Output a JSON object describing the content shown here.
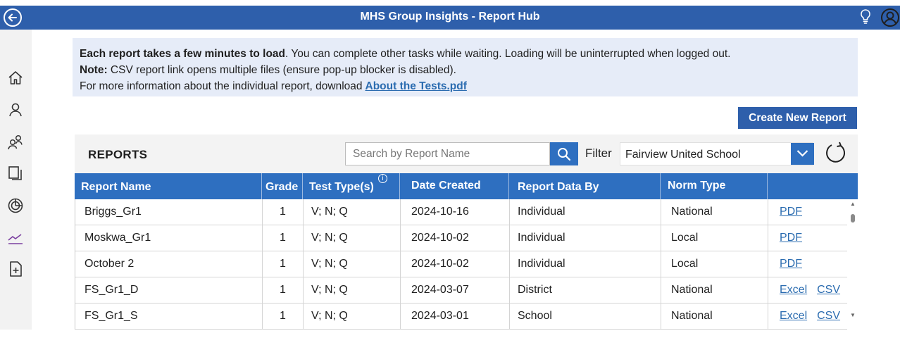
{
  "header": {
    "title": "MHS Group Insights - Report Hub"
  },
  "banner": {
    "line1_bold": "Each report takes a few minutes to load",
    "line1_rest": ". You can complete other tasks while waiting. Loading will be uninterrupted when logged out.",
    "line2_bold": "Note:",
    "line2_rest": " CSV report link opens multiple files (ensure pop-up blocker is disabled).",
    "line3_text": "For more information about the individual report, download",
    "line3_link": "About the Tests.pdf"
  },
  "actions": {
    "create_label": "Create New Report"
  },
  "reports": {
    "title": "REPORTS",
    "search_placeholder": "Search by Report Name",
    "filter_label": "Filter",
    "filter_value": "Fairview United School",
    "columns": [
      "Report Name",
      "Grade",
      "Test Type(s)",
      "Date Created",
      "Report Data By",
      "Norm Type"
    ],
    "info_glyph": "i",
    "rows": [
      {
        "name": "Briggs_Gr1",
        "grade": "1",
        "tests": "V; N; Q",
        "date": "2024-10-16",
        "data_by": "Individual",
        "norm": "National",
        "links": [
          "PDF"
        ]
      },
      {
        "name": "Moskwa_Gr1",
        "grade": "1",
        "tests": "V; N; Q",
        "date": "2024-10-02",
        "data_by": "Individual",
        "norm": "Local",
        "links": [
          "PDF"
        ]
      },
      {
        "name": "October 2",
        "grade": "1",
        "tests": "V; N; Q",
        "date": "2024-10-02",
        "data_by": "Individual",
        "norm": "Local",
        "links": [
          "PDF"
        ]
      },
      {
        "name": "FS_Gr1_D",
        "grade": "1",
        "tests": "V; N; Q",
        "date": "2024-03-07",
        "data_by": "District",
        "norm": "National",
        "links": [
          "Excel",
          "CSV"
        ]
      },
      {
        "name": "FS_Gr1_S",
        "grade": "1",
        "tests": "V; N; Q",
        "date": "2024-03-01",
        "data_by": "School",
        "norm": "National",
        "links": [
          "Excel",
          "CSV"
        ]
      }
    ]
  },
  "colors": {
    "primary": "#2e5fab",
    "header": "#2e6fc0",
    "banner_bg": "#e6ecf8",
    "link": "#2b6cb0"
  }
}
